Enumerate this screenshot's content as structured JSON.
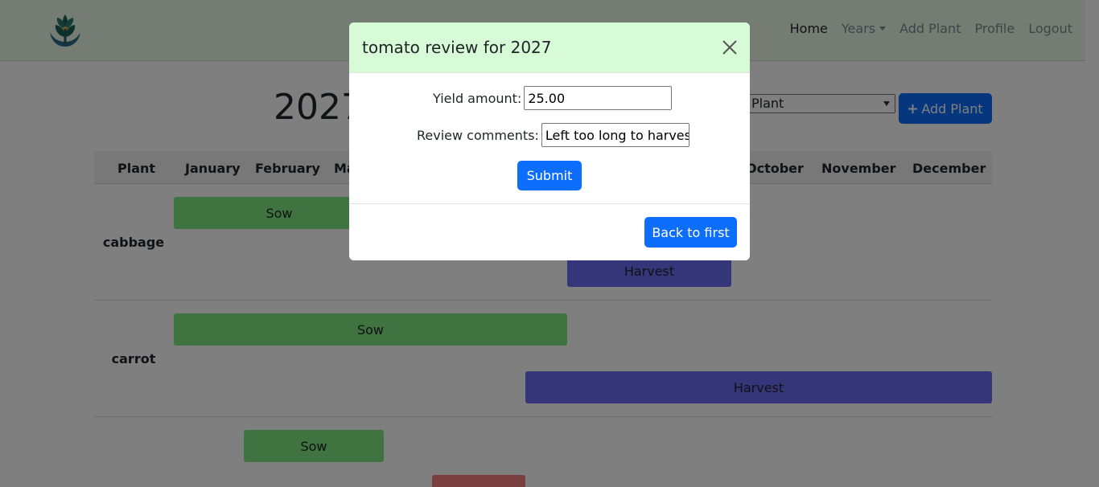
{
  "navbar": {
    "links": [
      "Home",
      "Years",
      "Add Plant",
      "Profile",
      "Logout"
    ]
  },
  "page": {
    "year_title": "2027",
    "plant_select_value": "Plant",
    "add_plant_label": "Add Plant",
    "add_plant_icon": "plus-icon"
  },
  "table": {
    "headers": [
      "Plant",
      "January",
      "February",
      "Ma",
      "October",
      "November",
      "December"
    ],
    "rows": [
      {
        "plant": "cabbage",
        "bars": [
          {
            "label": "Sow",
            "type": "sow"
          },
          {
            "label": "Harvest",
            "type": "harvest"
          }
        ]
      },
      {
        "plant": "carrot",
        "bars": [
          {
            "label": "Sow",
            "type": "sow"
          },
          {
            "label": "Harvest",
            "type": "harvest"
          }
        ]
      },
      {
        "plant": "",
        "bars": [
          {
            "label": "Sow",
            "type": "sow"
          },
          {
            "label": "",
            "type": "other"
          }
        ]
      }
    ]
  },
  "colors": {
    "navbar_bg": "#eaf8e8",
    "modal_header_bg": "#d7fbd6",
    "primary": "#0d6efd",
    "sow": "#7ee67e",
    "harvest": "#6a6af5",
    "other": "#f58080"
  },
  "modal": {
    "title": "tomato review for 2027",
    "close_icon": "close-icon",
    "yield_label": "Yield amount:",
    "yield_value": "25.00",
    "comments_label": "Review comments:",
    "comments_value": "Left too long to harvest",
    "submit_label": "Submit",
    "back_label": "Back to first"
  }
}
